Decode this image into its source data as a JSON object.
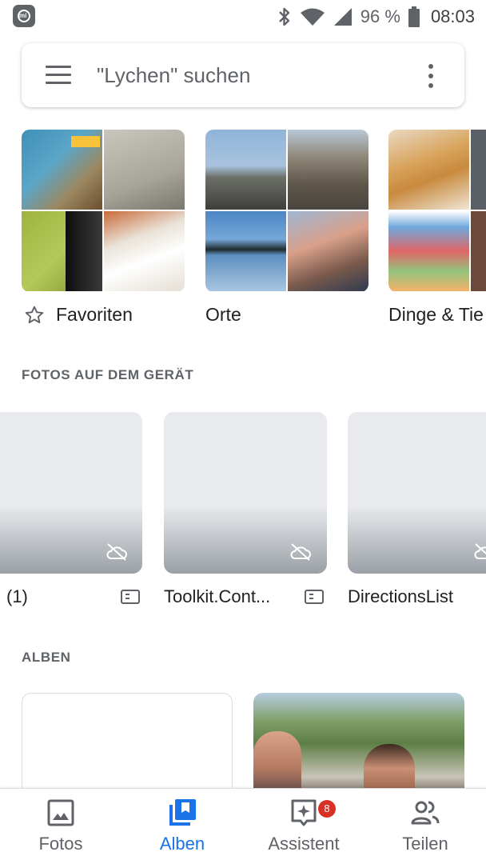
{
  "status_bar": {
    "battery_percent": "96 %",
    "time": "08:03",
    "icons": [
      "mi-icon",
      "bluetooth-icon",
      "wifi-icon",
      "cell-signal-icon",
      "battery-icon"
    ]
  },
  "search": {
    "placeholder": "\"Lychen\" suchen",
    "icons": [
      "menu-icon",
      "more-vert-icon"
    ]
  },
  "collections": [
    {
      "label": "Favoriten",
      "icon": "star-outline-icon"
    },
    {
      "label": "Orte"
    },
    {
      "label": "Dinge & Tie"
    }
  ],
  "device_section": {
    "title": "FOTOS AUF DEM GERÄT",
    "folders": [
      {
        "label": "(1)",
        "icon": "cloud-off-icon"
      },
      {
        "label": "Toolkit.Cont...",
        "icon": "cloud-off-icon"
      },
      {
        "label": "DirectionsList",
        "icon": "cloud-off-icon"
      }
    ]
  },
  "albums_section": {
    "title": "ALBEN"
  },
  "bottom_nav": {
    "items": [
      {
        "label": "Fotos",
        "icon": "photo-icon",
        "active": false
      },
      {
        "label": "Alben",
        "icon": "album-icon",
        "active": true
      },
      {
        "label": "Assistent",
        "icon": "assistant-icon",
        "active": false,
        "badge": "8"
      },
      {
        "label": "Teilen",
        "icon": "people-icon",
        "active": false
      }
    ]
  },
  "colors": {
    "accent": "#1a73e8",
    "badge": "#d93025",
    "text_secondary": "#5f6368"
  }
}
